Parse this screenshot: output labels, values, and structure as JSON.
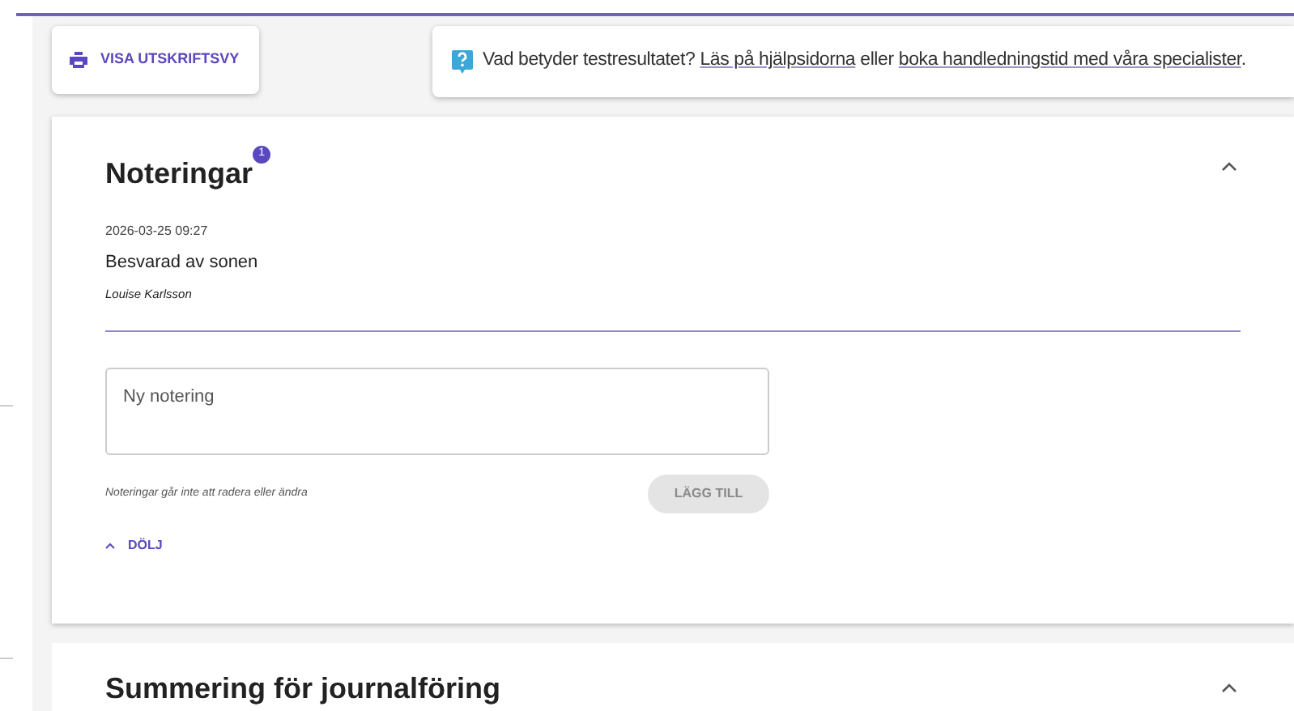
{
  "print_button": {
    "label": "VISA UTSKRIFTSVY"
  },
  "help": {
    "segments": [
      {
        "kind": "text",
        "text": "Vad betyder testresultatet? "
      },
      {
        "kind": "link",
        "text": "Läs på hjälpsidorna"
      },
      {
        "kind": "text",
        "text": " eller "
      },
      {
        "kind": "link",
        "text": "boka handledningstid med våra specialister"
      },
      {
        "kind": "text",
        "text": "."
      }
    ]
  },
  "notes_panel": {
    "title": "Noteringar",
    "badge": "1",
    "expanded": true,
    "notes": [
      {
        "timestamp": "2026-03-25 09:27",
        "text": "Besvarad av sonen",
        "author": "Louise Karlsson"
      }
    ],
    "new_note": {
      "placeholder": "Ny notering"
    },
    "hint": "Noteringar går inte att radera eller ändra",
    "add_button": {
      "label": "LÄGG TILL",
      "disabled": true
    },
    "hide_link": {
      "label": "DÖLJ"
    }
  },
  "summary_panel": {
    "title": "Summering för journalföring",
    "expanded": true
  }
}
